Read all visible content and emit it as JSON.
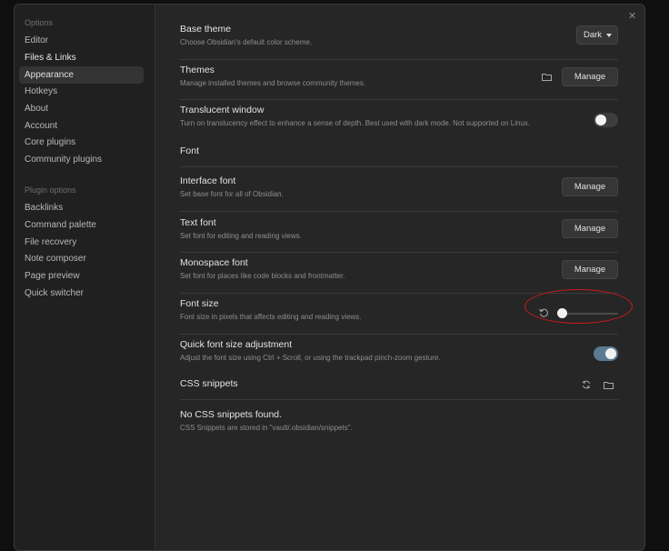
{
  "sidebar": {
    "options_label": "Options",
    "options_items": [
      {
        "label": "Editor"
      },
      {
        "label": "Files & Links"
      },
      {
        "label": "Appearance"
      },
      {
        "label": "Hotkeys"
      },
      {
        "label": "About"
      },
      {
        "label": "Account"
      },
      {
        "label": "Core plugins"
      },
      {
        "label": "Community plugins"
      }
    ],
    "plugin_label": "Plugin options",
    "plugin_items": [
      {
        "label": "Backlinks"
      },
      {
        "label": "Command palette"
      },
      {
        "label": "File recovery"
      },
      {
        "label": "Note composer"
      },
      {
        "label": "Page preview"
      },
      {
        "label": "Quick switcher"
      }
    ],
    "active_item": "Appearance"
  },
  "settings": {
    "base_theme": {
      "title": "Base theme",
      "desc": "Choose Obsidian's default color scheme.",
      "value": "Dark"
    },
    "themes": {
      "title": "Themes",
      "desc": "Manage installed themes and browse community themes.",
      "button": "Manage"
    },
    "translucent": {
      "title": "Translucent window",
      "desc": "Turn on translucency effect to enhance a sense of depth. Best used with dark mode. Not supported on Linux.",
      "enabled": false
    },
    "font_heading": "Font",
    "interface_font": {
      "title": "Interface font",
      "desc": "Set base font for all of Obsidian.",
      "button": "Manage"
    },
    "text_font": {
      "title": "Text font",
      "desc": "Set font for editing and reading views.",
      "button": "Manage"
    },
    "monospace_font": {
      "title": "Monospace font",
      "desc": "Set font for places like code blocks and frontmatter.",
      "button": "Manage"
    },
    "font_size": {
      "title": "Font size",
      "desc": "Font size in pixels that affects editing and reading views.",
      "slider_fraction": 0.0
    },
    "quick_font": {
      "title": "Quick font size adjustment",
      "desc": "Adjust the font size using Ctrl + Scroll, or using the trackpad pinch-zoom gesture.",
      "enabled": true
    },
    "css_snippets": {
      "title": "CSS snippets"
    },
    "no_snippets": {
      "title": "No CSS snippets found.",
      "desc": "CSS Snippets are stored in \"vault/.obsidian/snippets\"."
    }
  },
  "icons": {
    "close": "close-icon",
    "folder": "folder-icon",
    "reset": "reset-icon",
    "reload": "reload-icon"
  },
  "colors": {
    "accent_toggle": "#5a7a92",
    "annotation": "#d21a1a"
  }
}
